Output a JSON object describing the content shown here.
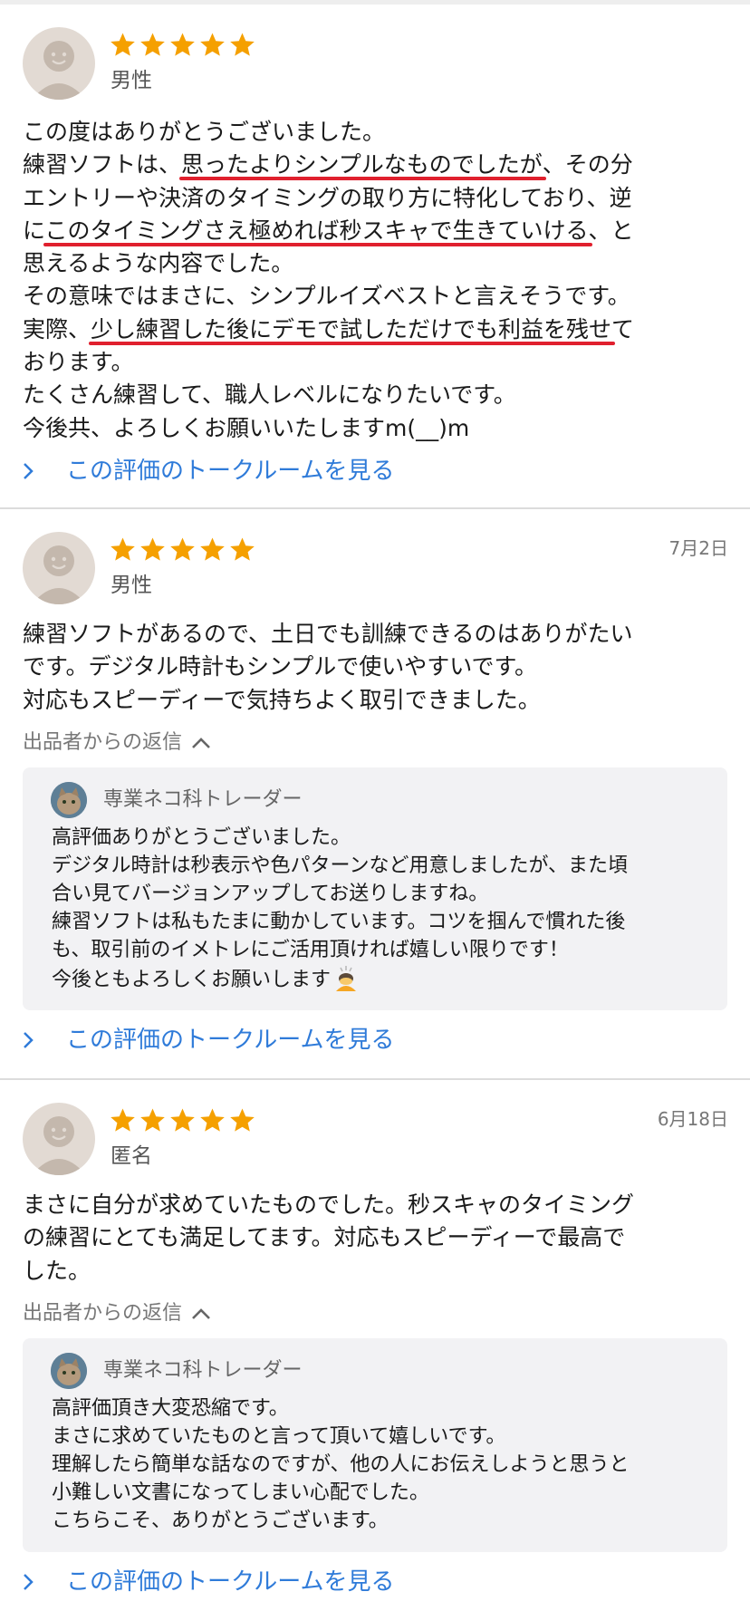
{
  "reviews": [
    {
      "rating": 5,
      "user": "男性",
      "date": "",
      "body_lines": [
        [
          {
            "t": "この度はありがとうございました。"
          }
        ],
        [
          {
            "t": "練習ソフトは、"
          },
          {
            "t": "思ったよりシンプルなものでしたが",
            "u": true
          },
          {
            "t": "、その分"
          }
        ],
        [
          {
            "t": "エントリーや決済のタイミングの取り方に特化しており、逆"
          }
        ],
        [
          {
            "t": "に"
          },
          {
            "t": "このタイミングさえ極めれば秒スキャで生きていける",
            "u": true
          },
          {
            "t": "、と"
          }
        ],
        [
          {
            "t": "思えるような内容でした。"
          }
        ],
        [
          {
            "t": "その意味ではまさに、シンプルイズベストと言えそうです。"
          }
        ],
        [
          {
            "t": "実際、"
          },
          {
            "t": "少し練習した後にデモで試しただけでも利益を残せ",
            "u": true
          },
          {
            "t": "て"
          }
        ],
        [
          {
            "t": "おります。"
          }
        ],
        [
          {
            "t": "たくさん練習して、職人レベルになりたいです。"
          }
        ],
        [
          {
            "t": "今後共、よろしくお願いいたしますm(__)m"
          }
        ]
      ],
      "talk_link": "この評価のトークルームを見る"
    },
    {
      "rating": 5,
      "user": "男性",
      "date": "7月2日",
      "body_lines": [
        [
          {
            "t": "練習ソフトがあるので、土日でも訓練できるのはありがたい"
          }
        ],
        [
          {
            "t": "です。デジタル時計もシンプルで使いやすいです。"
          }
        ],
        [
          {
            "t": "対応もスピーディーで気持ちよく取引できました。"
          }
        ]
      ],
      "reply_label": "出品者からの返信",
      "seller_name": "専業ネコ科トレーダー",
      "reply_lines": [
        "高評価ありがとうございました。",
        "デジタル時計は秒表示や色パターンなど用意しましたが、また頃",
        "合い見てバージョンアップしてお送りしますね。",
        "練習ソフトは私もたまに動かしています。コツを掴んで慣れた後",
        "も、取引前のイメトレにご活用頂ければ嬉しい限りです！",
        "今後ともよろしくお願いします"
      ],
      "talk_link": "この評価のトークルームを見る"
    },
    {
      "rating": 5,
      "user": "匿名",
      "date": "6月18日",
      "body_lines": [
        [
          {
            "t": "まさに自分が求めていたものでした。秒スキャのタイミング"
          }
        ],
        [
          {
            "t": "の練習にとても満足してます。対応もスピーディーで最高で"
          }
        ],
        [
          {
            "t": "した。"
          }
        ]
      ],
      "reply_label": "出品者からの返信",
      "seller_name": "専業ネコ科トレーダー",
      "reply_lines": [
        "高評価頂き大変恐縮です。",
        "まさに求めていたものと言って頂いて嬉しいです。",
        "理解したら簡単な話なのですが、他の人にお伝えしようと思うと",
        "小難しい文書になってしまい心配でした。",
        "こちらこそ、ありがとうございます。"
      ],
      "talk_link": "この評価のトークルームを見る"
    }
  ],
  "colors": {
    "star": "#f5a000",
    "link": "#2f7bd9",
    "underline": "#e0202e"
  }
}
